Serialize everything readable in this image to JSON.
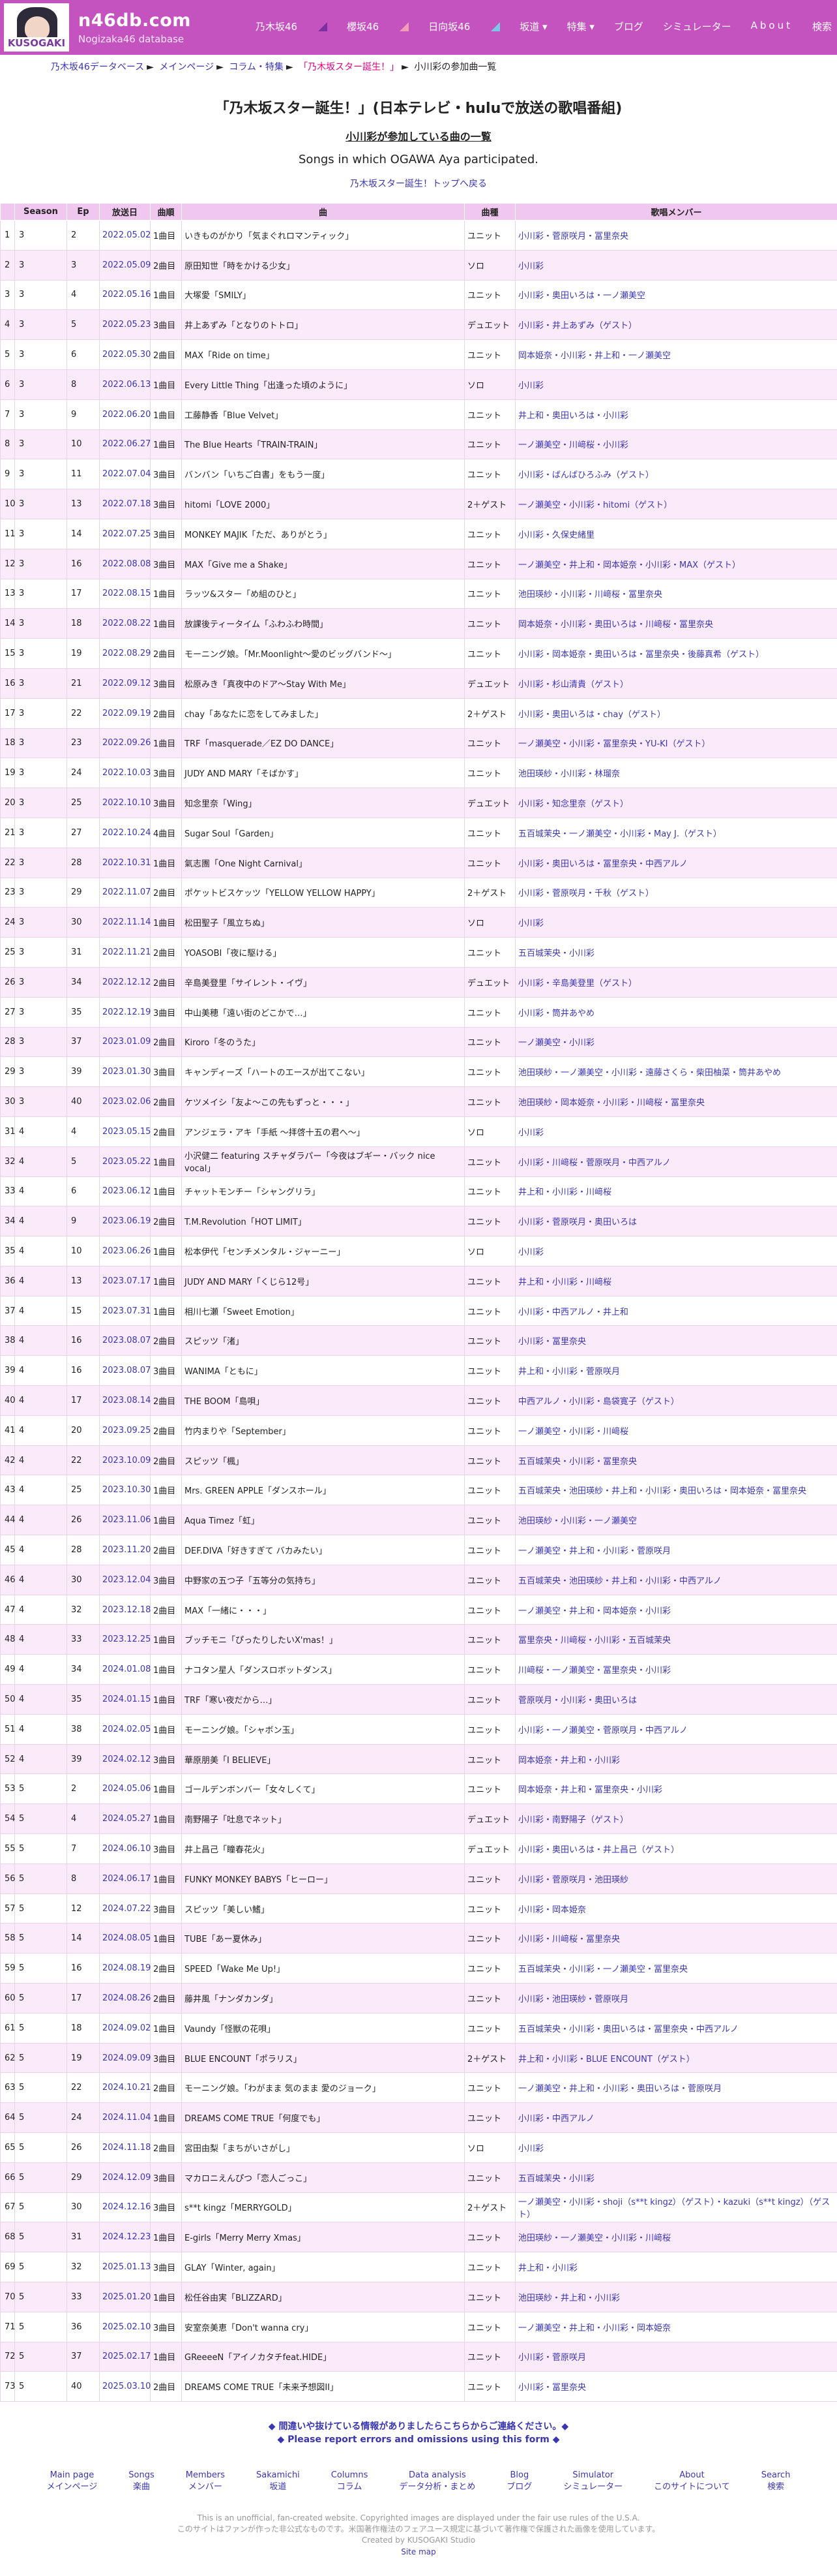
{
  "site": {
    "logo_text": "KUSOGAKI",
    "title": "n46db.com",
    "subtitle": "Nogizaka46 database"
  },
  "nav": [
    "乃木坂46",
    "櫻坂46",
    "日向坂46",
    "坂道 ▾",
    "特集 ▾",
    "ブログ",
    "シミュレーター",
    "About",
    "検索"
  ],
  "breadcrumb": [
    "乃木坂46データベース",
    "メインページ",
    "コラム・特集",
    "「乃木坂スター誕生！」",
    "小川彩の参加曲一覧"
  ],
  "page": {
    "title": "「乃木坂スター誕生！」(日本テレビ・huluで放送の歌唱番組)",
    "subtitle": "小川彩が参加している曲の一覧",
    "subtitle_en": "Songs in which OGAWA Aya participated.",
    "back_link": "乃木坂スター誕生！トップへ戻る"
  },
  "table": {
    "headers": [
      "",
      "Season",
      "Ep",
      "放送日",
      "曲順",
      "曲",
      "曲種",
      "歌唱メンバー"
    ],
    "rows": [
      [
        "1",
        "3",
        "2",
        "2022.05.02",
        "1曲目",
        "いきものがかり「気まぐれロマンティック」",
        "ユニット",
        "小川彩・菅原咲月・冨里奈央"
      ],
      [
        "2",
        "3",
        "3",
        "2022.05.09",
        "2曲目",
        "原田知世「時をかける少女」",
        "ソロ",
        "小川彩"
      ],
      [
        "3",
        "3",
        "4",
        "2022.05.16",
        "1曲目",
        "大塚愛「SMILY」",
        "ユニット",
        "小川彩・奥田いろは・一ノ瀬美空"
      ],
      [
        "4",
        "3",
        "5",
        "2022.05.23",
        "3曲目",
        "井上あずみ「となりのトトロ」",
        "デュエット",
        "小川彩・井上あずみ（ゲスト）"
      ],
      [
        "5",
        "3",
        "6",
        "2022.05.30",
        "2曲目",
        "MAX「Ride on time」",
        "ユニット",
        "岡本姫奈・小川彩・井上和・一ノ瀬美空"
      ],
      [
        "6",
        "3",
        "8",
        "2022.06.13",
        "1曲目",
        "Every Little Thing「出逢った頃のように」",
        "ソロ",
        "小川彩"
      ],
      [
        "7",
        "3",
        "9",
        "2022.06.20",
        "1曲目",
        "工藤静香「Blue Velvet」",
        "ユニット",
        "井上和・奥田いろは・小川彩"
      ],
      [
        "8",
        "3",
        "10",
        "2022.06.27",
        "1曲目",
        "The Blue Hearts「TRAIN-TRAIN」",
        "ユニット",
        "一ノ瀬美空・川﨑桜・小川彩"
      ],
      [
        "9",
        "3",
        "11",
        "2022.07.04",
        "3曲目",
        "バンバン「いちご白書」をもう一度」",
        "ユニット",
        "小川彩・ばんばひろふみ（ゲスト）"
      ],
      [
        "10",
        "3",
        "13",
        "2022.07.18",
        "3曲目",
        "hitomi「LOVE 2000」",
        "2＋ゲスト",
        "一ノ瀬美空・小川彩・hitomi（ゲスト）"
      ],
      [
        "11",
        "3",
        "14",
        "2022.07.25",
        "3曲目",
        "MONKEY MAJIK「ただ、ありがとう」",
        "ユニット",
        "小川彩・久保史緒里"
      ],
      [
        "12",
        "3",
        "16",
        "2022.08.08",
        "3曲目",
        "MAX「Give me a Shake」",
        "ユニット",
        "一ノ瀬美空・井上和・岡本姫奈・小川彩・MAX（ゲスト）"
      ],
      [
        "13",
        "3",
        "17",
        "2022.08.15",
        "1曲目",
        "ラッツ&スター「め組のひと」",
        "ユニット",
        "池田瑛紗・小川彩・川﨑桜・冨里奈央"
      ],
      [
        "14",
        "3",
        "18",
        "2022.08.22",
        "1曲目",
        "放課後ティータイム「ふわふわ時間」",
        "ユニット",
        "岡本姫奈・小川彩・奥田いろは・川﨑桜・冨里奈央"
      ],
      [
        "15",
        "3",
        "19",
        "2022.08.29",
        "2曲目",
        "モーニング娘。「Mr.Moonlight〜愛のビッグバンド〜」",
        "ユニット",
        "小川彩・岡本姫奈・奥田いろは・冨里奈央・後藤真希（ゲスト）"
      ],
      [
        "16",
        "3",
        "21",
        "2022.09.12",
        "3曲目",
        "松原みき「真夜中のドア〜Stay With Me」",
        "デュエット",
        "小川彩・杉山清貴（ゲスト）"
      ],
      [
        "17",
        "3",
        "22",
        "2022.09.19",
        "2曲目",
        "chay「あなたに恋をしてみました」",
        "2＋ゲスト",
        "小川彩・奥田いろは・chay（ゲスト）"
      ],
      [
        "18",
        "3",
        "23",
        "2022.09.26",
        "1曲目",
        "TRF「masquerade／EZ DO DANCE」",
        "ユニット",
        "一ノ瀬美空・小川彩・冨里奈央・YU-KI（ゲスト）"
      ],
      [
        "19",
        "3",
        "24",
        "2022.10.03",
        "3曲目",
        "JUDY AND MARY「そばかす」",
        "ユニット",
        "池田瑛紗・小川彩・林瑠奈"
      ],
      [
        "20",
        "3",
        "25",
        "2022.10.10",
        "3曲目",
        "知念里奈「Wing」",
        "デュエット",
        "小川彩・知念里奈（ゲスト）"
      ],
      [
        "21",
        "3",
        "27",
        "2022.10.24",
        "4曲目",
        "Sugar Soul「Garden」",
        "ユニット",
        "五百城茉央・一ノ瀬美空・小川彩・May J.（ゲスト）"
      ],
      [
        "22",
        "3",
        "28",
        "2022.10.31",
        "1曲目",
        "氣志團「One Night Carnival」",
        "ユニット",
        "小川彩・奥田いろは・冨里奈央・中西アルノ"
      ],
      [
        "23",
        "3",
        "29",
        "2022.11.07",
        "2曲目",
        "ポケットビスケッツ「YELLOW YELLOW HAPPY」",
        "2＋ゲスト",
        "小川彩・菅原咲月・千秋（ゲスト）"
      ],
      [
        "24",
        "3",
        "30",
        "2022.11.14",
        "1曲目",
        "松田聖子「風立ちぬ」",
        "ソロ",
        "小川彩"
      ],
      [
        "25",
        "3",
        "31",
        "2022.11.21",
        "2曲目",
        "YOASOBI「夜に駆ける」",
        "ユニット",
        "五百城茉央・小川彩"
      ],
      [
        "26",
        "3",
        "34",
        "2022.12.12",
        "2曲目",
        "辛島美登里「サイレント・イヴ」",
        "デュエット",
        "小川彩・辛島美登里（ゲスト）"
      ],
      [
        "27",
        "3",
        "35",
        "2022.12.19",
        "3曲目",
        "中山美穂「遠い街のどこかで…」",
        "ユニット",
        "小川彩・筒井あやめ"
      ],
      [
        "28",
        "3",
        "37",
        "2023.01.09",
        "2曲目",
        "Kiroro「冬のうた」",
        "ユニット",
        "一ノ瀬美空・小川彩"
      ],
      [
        "29",
        "3",
        "39",
        "2023.01.30",
        "3曲目",
        "キャンディーズ「ハートのエースが出てこない」",
        "ユニット",
        "池田瑛紗・一ノ瀬美空・小川彩・遠藤さくら・柴田柚菜・筒井あやめ"
      ],
      [
        "30",
        "3",
        "40",
        "2023.02.06",
        "2曲目",
        "ケツメイシ「友よ〜この先もずっと・・・」",
        "ユニット",
        "池田瑛紗・岡本姫奈・小川彩・川﨑桜・冨里奈央"
      ],
      [
        "31",
        "4",
        "4",
        "2023.05.15",
        "2曲目",
        "アンジェラ・アキ「手紙 〜拝啓十五の君へ〜」",
        "ソロ",
        "小川彩"
      ],
      [
        "32",
        "4",
        "5",
        "2023.05.22",
        "1曲目",
        "小沢健二 featuring スチャダラパー「今夜はブギー・バック nice vocal」",
        "ユニット",
        "小川彩・川﨑桜・菅原咲月・中西アルノ"
      ],
      [
        "33",
        "4",
        "6",
        "2023.06.12",
        "1曲目",
        "チャットモンチー「シャングリラ」",
        "ユニット",
        "井上和・小川彩・川﨑桜"
      ],
      [
        "34",
        "4",
        "9",
        "2023.06.19",
        "2曲目",
        "T.M.Revolution「HOT LIMIT」",
        "ユニット",
        "小川彩・菅原咲月・奥田いろは"
      ],
      [
        "35",
        "4",
        "10",
        "2023.06.26",
        "1曲目",
        "松本伊代「センチメンタル・ジャーニー」",
        "ソロ",
        "小川彩"
      ],
      [
        "36",
        "4",
        "13",
        "2023.07.17",
        "1曲目",
        "JUDY AND MARY「くじら12号」",
        "ユニット",
        "井上和・小川彩・川﨑桜"
      ],
      [
        "37",
        "4",
        "15",
        "2023.07.31",
        "1曲目",
        "相川七瀬「Sweet Emotion」",
        "ユニット",
        "小川彩・中西アルノ・井上和"
      ],
      [
        "38",
        "4",
        "16",
        "2023.08.07",
        "2曲目",
        "スピッツ「渚」",
        "ユニット",
        "小川彩・冨里奈央"
      ],
      [
        "39",
        "4",
        "16",
        "2023.08.07",
        "3曲目",
        "WANIMA「ともに」",
        "ユニット",
        "井上和・小川彩・菅原咲月"
      ],
      [
        "40",
        "4",
        "17",
        "2023.08.14",
        "2曲目",
        "THE BOOM「島唄」",
        "ユニット",
        "中西アルノ・小川彩・島袋寛子（ゲスト）"
      ],
      [
        "41",
        "4",
        "20",
        "2023.09.25",
        "2曲目",
        "竹内まりや「September」",
        "ユニット",
        "一ノ瀬美空・小川彩・川﨑桜"
      ],
      [
        "42",
        "4",
        "22",
        "2023.10.09",
        "2曲目",
        "スピッツ「楓」",
        "ユニット",
        "五百城茉央・小川彩・冨里奈央"
      ],
      [
        "43",
        "4",
        "25",
        "2023.10.30",
        "1曲目",
        "Mrs. GREEN APPLE「ダンスホール」",
        "ユニット",
        "五百城茉央・池田瑛紗・井上和・小川彩・奥田いろは・岡本姫奈・冨里奈央"
      ],
      [
        "44",
        "4",
        "26",
        "2023.11.06",
        "1曲目",
        "Aqua Timez「虹」",
        "ユニット",
        "池田瑛紗・小川彩・一ノ瀬美空"
      ],
      [
        "45",
        "4",
        "28",
        "2023.11.20",
        "2曲目",
        "DEF.DIVA「好きすぎて バカみたい」",
        "ユニット",
        "一ノ瀬美空・井上和・小川彩・菅原咲月"
      ],
      [
        "46",
        "4",
        "30",
        "2023.12.04",
        "3曲目",
        "中野家の五つ子「五等分の気持ち」",
        "ユニット",
        "五百城茉央・池田瑛紗・井上和・小川彩・中西アルノ"
      ],
      [
        "47",
        "4",
        "32",
        "2023.12.18",
        "2曲目",
        "MAX「一緒に・・・」",
        "ユニット",
        "一ノ瀬美空・井上和・岡本姫奈・小川彩"
      ],
      [
        "48",
        "4",
        "33",
        "2023.12.25",
        "1曲目",
        "ブッチモニ「ぴったりしたいX'mas！」",
        "ユニット",
        "冨里奈央・川﨑桜・小川彩・五百城茉央"
      ],
      [
        "49",
        "4",
        "34",
        "2024.01.08",
        "1曲目",
        "ナコタン星人「ダンスロボットダンス」",
        "ユニット",
        "川﨑桜・一ノ瀬美空・冨里奈央・小川彩"
      ],
      [
        "50",
        "4",
        "35",
        "2024.01.15",
        "1曲目",
        "TRF「寒い夜だから…」",
        "ユニット",
        "菅原咲月・小川彩・奥田いろは"
      ],
      [
        "51",
        "4",
        "38",
        "2024.02.05",
        "1曲目",
        "モーニング娘。「シャボン玉」",
        "ユニット",
        "小川彩・一ノ瀬美空・菅原咲月・中西アルノ"
      ],
      [
        "52",
        "4",
        "39",
        "2024.02.12",
        "3曲目",
        "華原朋美「I BELIEVE」",
        "ユニット",
        "岡本姫奈・井上和・小川彩"
      ],
      [
        "53",
        "5",
        "2",
        "2024.05.06",
        "1曲目",
        "ゴールデンボンバー「女々しくて」",
        "ユニット",
        "岡本姫奈・井上和・冨里奈央・小川彩"
      ],
      [
        "54",
        "5",
        "4",
        "2024.05.27",
        "1曲目",
        "南野陽子「吐息でネット」",
        "デュエット",
        "小川彩・南野陽子（ゲスト）"
      ],
      [
        "55",
        "5",
        "7",
        "2024.06.10",
        "3曲目",
        "井上昌己「瞳春花火」",
        "デュエット",
        "小川彩・奥田いろは・井上昌己（ゲスト）"
      ],
      [
        "56",
        "5",
        "8",
        "2024.06.17",
        "1曲目",
        "FUNKY MONKEY BABYS「ヒーロー」",
        "ユニット",
        "小川彩・菅原咲月・池田瑛紗"
      ],
      [
        "57",
        "5",
        "12",
        "2024.07.22",
        "3曲目",
        "スピッツ「美しい鰭」",
        "ユニット",
        "小川彩・岡本姫奈"
      ],
      [
        "58",
        "5",
        "14",
        "2024.08.05",
        "1曲目",
        "TUBE「あー夏休み」",
        "ユニット",
        "小川彩・川﨑桜・冨里奈央"
      ],
      [
        "59",
        "5",
        "16",
        "2024.08.19",
        "2曲目",
        "SPEED「Wake Me Up!」",
        "ユニット",
        "五百城茉央・小川彩・一ノ瀬美空・冨里奈央"
      ],
      [
        "60",
        "5",
        "17",
        "2024.08.26",
        "2曲目",
        "藤井風「ナンダカンダ」",
        "ユニット",
        "小川彩・池田瑛紗・菅原咲月"
      ],
      [
        "61",
        "5",
        "18",
        "2024.09.02",
        "1曲目",
        "Vaundy「怪獣の花唄」",
        "ユニット",
        "五百城茉央・小川彩・奥田いろは・冨里奈央・中西アルノ"
      ],
      [
        "62",
        "5",
        "19",
        "2024.09.09",
        "3曲目",
        "BLUE ENCOUNT「ポラリス」",
        "2＋ゲスト",
        "井上和・小川彩・BLUE ENCOUNT（ゲスト）"
      ],
      [
        "63",
        "5",
        "22",
        "2024.10.21",
        "2曲目",
        "モーニング娘。「わがまま 気のまま 愛のジョーク」",
        "ユニット",
        "一ノ瀬美空・井上和・小川彩・奥田いろは・菅原咲月"
      ],
      [
        "64",
        "5",
        "24",
        "2024.11.04",
        "1曲目",
        "DREAMS COME TRUE「何度でも」",
        "ユニット",
        "小川彩・中西アルノ"
      ],
      [
        "65",
        "5",
        "26",
        "2024.11.18",
        "2曲目",
        "宮田由梨「まちがいさがし」",
        "ソロ",
        "小川彩"
      ],
      [
        "66",
        "5",
        "29",
        "2024.12.09",
        "3曲目",
        "マカロニえんぴつ「恋人ごっこ」",
        "ユニット",
        "五百城茉央・小川彩"
      ],
      [
        "67",
        "5",
        "30",
        "2024.12.16",
        "3曲目",
        "s**t kingz「MERRYGOLD」",
        "2＋ゲスト",
        "一ノ瀬美空・小川彩・shoji（s**t kingz）（ゲスト）・kazuki（s**t kingz）（ゲスト）"
      ],
      [
        "68",
        "5",
        "31",
        "2024.12.23",
        "1曲目",
        "E-girls「Merry Merry Xmas」",
        "ユニット",
        "池田瑛紗・一ノ瀬美空・小川彩・川﨑桜"
      ],
      [
        "69",
        "5",
        "32",
        "2025.01.13",
        "3曲目",
        "GLAY「Winter, again」",
        "ユニット",
        "井上和・小川彩"
      ],
      [
        "70",
        "5",
        "33",
        "2025.01.20",
        "1曲目",
        "松任谷由実「BLIZZARD」",
        "ユニット",
        "池田瑛紗・井上和・小川彩"
      ],
      [
        "71",
        "5",
        "36",
        "2025.02.10",
        "3曲目",
        "安室奈美恵「Don't wanna cry」",
        "ユニット",
        "一ノ瀬美空・井上和・小川彩・岡本姫奈"
      ],
      [
        "72",
        "5",
        "37",
        "2025.02.17",
        "1曲目",
        "GReeeeN「アイノカタチfeat.HIDE」",
        "ユニット",
        "小川彩・菅原咲月"
      ],
      [
        "73",
        "5",
        "40",
        "2025.03.10",
        "2曲目",
        "DREAMS COME TRUE「未来予想図II」",
        "ユニット",
        "小川彩・冨里奈央"
      ]
    ]
  },
  "footer": {
    "report_jp": "◆ 間違いや抜けている情報がありましたらこちらからご連絡ください。◆",
    "report_en": "◆ Please report errors and omissions using this form ◆",
    "links": [
      [
        "Main page",
        "メインページ"
      ],
      [
        "Songs",
        "楽曲"
      ],
      [
        "Members",
        "メンバー"
      ],
      [
        "Sakamichi",
        "坂道"
      ],
      [
        "Columns",
        "コラム"
      ],
      [
        "Data analysis",
        "データ分析・まとめ"
      ],
      [
        "Blog",
        "ブログ"
      ],
      [
        "Simulator",
        "シミュレーター"
      ],
      [
        "About",
        "このサイトについて"
      ],
      [
        "Search",
        "検索"
      ]
    ],
    "copy1": "This is an unofficial, fan-created website. Copyrighted images are displayed under the fair use rules of the U.S.A.",
    "copy2": "このサイトはファンが作った非公式なものです。米国著作権法のフェアユース規定に基づいて著作権で保護された画像を使用しています。",
    "copy3": "Created by KUSOGAKI Studio",
    "sitemap": "Site map"
  },
  "colors": {
    "header": "#c452bf",
    "th": "#f0c7ef",
    "row_alt": "#fbeafa",
    "link": "#3a36b0"
  }
}
